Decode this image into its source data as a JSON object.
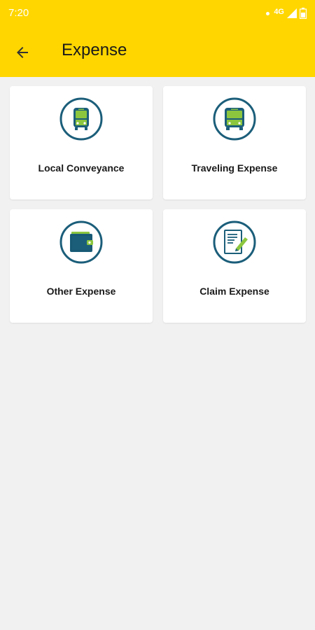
{
  "status_bar": {
    "time": "7:20",
    "network": "4G",
    "icons": [
      "signal-icon",
      "battery-icon"
    ]
  },
  "app_bar": {
    "title": "Expense",
    "back_icon": "back-arrow-icon",
    "background": "#ffd600"
  },
  "cards": [
    {
      "label": "Local Conveyance",
      "icon": "bus-icon"
    },
    {
      "label": "Traveling Expense",
      "icon": "bus-icon"
    },
    {
      "label": "Other Expense",
      "icon": "wallet-icon"
    },
    {
      "label": "Claim Expense",
      "icon": "document-pen-icon"
    }
  ],
  "colors": {
    "accent": "#ffd600",
    "icon_ring": "#1b5e7a",
    "icon_green": "#8cc63f",
    "background": "#f1f1f1"
  }
}
